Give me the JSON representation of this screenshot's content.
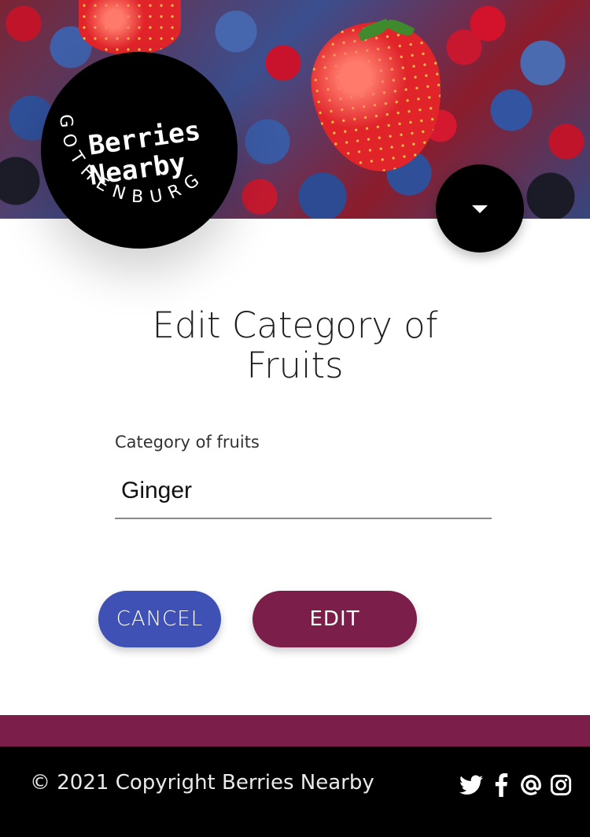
{
  "logo": {
    "line1": "Berries",
    "line2": "Nearby",
    "city": "GOTHENBURG"
  },
  "menu": {
    "icon": "caret-down-icon"
  },
  "page": {
    "title_line1": "Edit Category of",
    "title_line2": "Fruits"
  },
  "form": {
    "label": "Category of fruits",
    "value": "Ginger"
  },
  "actions": {
    "cancel_label": "CANCEL",
    "edit_label": "EDIT"
  },
  "footer": {
    "copyright": "© 2021 Copyright Berries Nearby",
    "social_icons": [
      "twitter-icon",
      "facebook-icon",
      "email-icon",
      "instagram-icon"
    ]
  },
  "colors": {
    "accent": "#7b1e4a",
    "cancel": "#3f51b5",
    "footer_bg": "#000000"
  }
}
